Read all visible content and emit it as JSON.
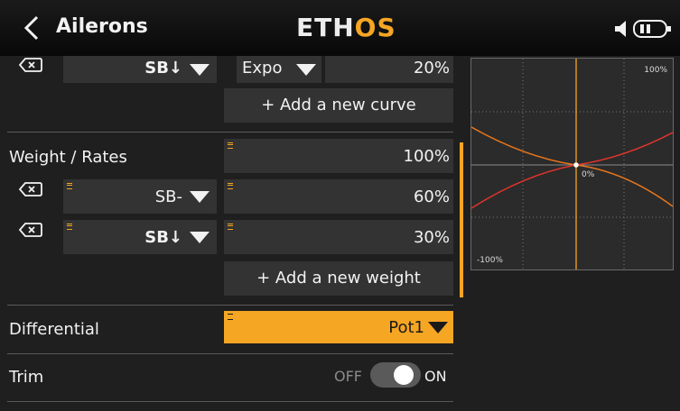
{
  "header": {
    "title": "Ailerons",
    "logo_left": "ETH",
    "logo_right": "OS"
  },
  "expo_row": {
    "switch": "SB↓",
    "curve_type": "Expo",
    "curve_value": "20%"
  },
  "add_curve_label": "+ Add a new curve",
  "weight": {
    "label": "Weight / Rates",
    "main_value": "100%",
    "rates": [
      {
        "switch": "SB-",
        "value": "60%"
      },
      {
        "switch": "SB↓",
        "value": "30%"
      }
    ],
    "add_label": "+ Add a new weight"
  },
  "differential": {
    "label": "Differential",
    "value": "Pot1"
  },
  "trim": {
    "label": "Trim",
    "off_label": "OFF",
    "on_label": "ON",
    "state": "on"
  },
  "graph": {
    "top_label": "100%",
    "bottom_label": "-100%",
    "center_label": "0%"
  },
  "colors": {
    "accent": "#f5a623",
    "curve_red": "#e0342c",
    "curve_orange": "#e8761c"
  }
}
